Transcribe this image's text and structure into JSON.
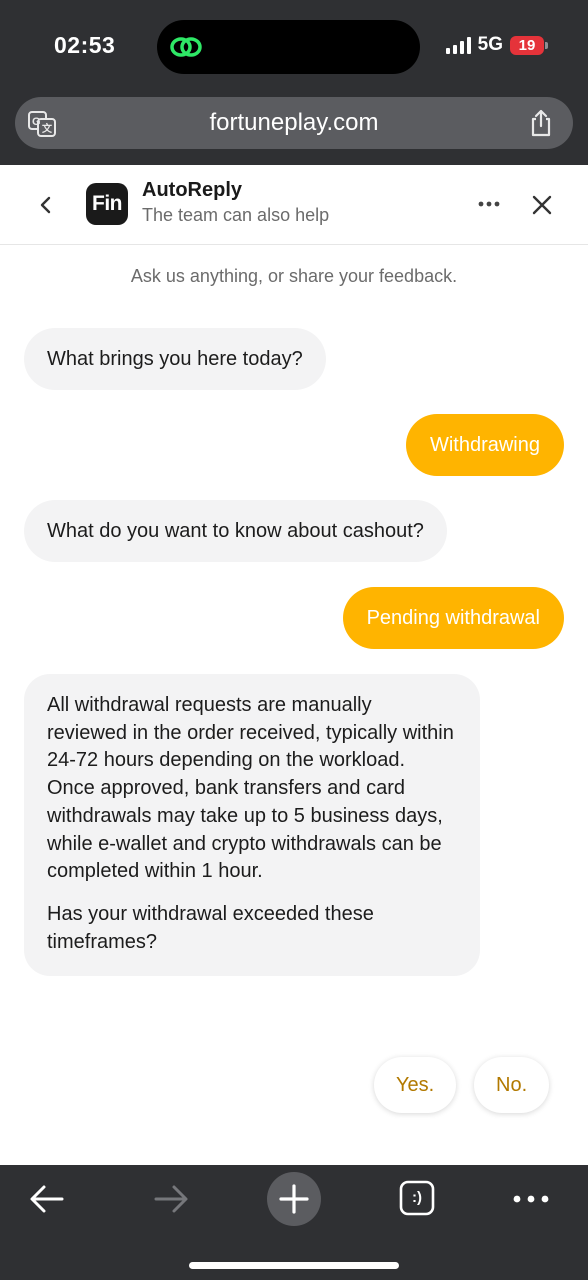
{
  "status_bar": {
    "time": "02:53",
    "network": "5G",
    "battery": "19"
  },
  "browser": {
    "url": "fortuneplay.com"
  },
  "chat_header": {
    "logo_text": "Fin",
    "title": "AutoReply",
    "subtitle": "The team can also help"
  },
  "conversation": {
    "intro": "Ask us anything, or share your feedback.",
    "messages": [
      {
        "from": "bot",
        "text": "What brings you here today?"
      },
      {
        "from": "user",
        "text": "Withdrawing"
      },
      {
        "from": "bot",
        "text": "What do you want to know about cashout?"
      },
      {
        "from": "user",
        "text": "Pending withdrawal"
      },
      {
        "from": "bot",
        "paragraphs": [
          "All withdrawal requests are manually reviewed in the order received, typically within 24-72 hours depending on the workload. Once approved, bank transfers and card withdrawals may take up to 5 business days, while e-wallet and crypto withdrawals can be completed within 1 hour.",
          "Has your withdrawal exceeded these timeframes?"
        ]
      }
    ],
    "quick_replies": [
      "Yes.",
      "No."
    ]
  },
  "toolbar": {
    "tabs_label": ":)"
  },
  "colors": {
    "accent": "#ffb400",
    "quick_reply_text": "#b27900",
    "bot_bubble": "#f3f3f4",
    "chrome": "#2f3033"
  },
  "icons": [
    "messages-app-icon",
    "signal-icon",
    "battery-icon",
    "translate-icon",
    "share-icon",
    "chevron-left-icon",
    "more-horizontal-icon",
    "close-icon",
    "arrow-left-icon",
    "arrow-right-icon",
    "plus-icon",
    "tabs-icon",
    "more-icon"
  ]
}
